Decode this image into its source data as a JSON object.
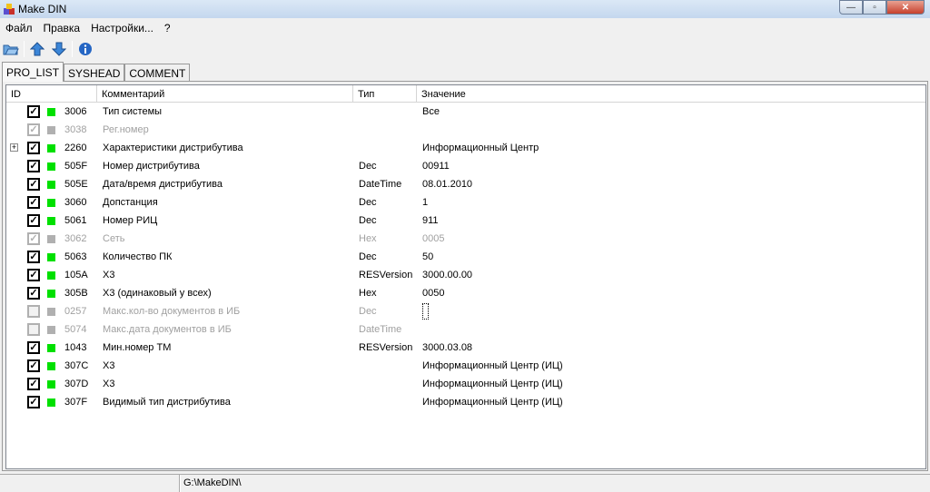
{
  "window": {
    "title": "Make DIN",
    "minimize": "—",
    "maximize": "▫",
    "close": "✕"
  },
  "menu": [
    "Файл",
    "Правка",
    "Настройки...",
    "?"
  ],
  "tabs": [
    "PRO_LIST",
    "SYSHEAD",
    "COMMENT"
  ],
  "columns": [
    "ID",
    "Комментарий",
    "Тип",
    "Значение"
  ],
  "rows": [
    {
      "id": "3006",
      "comment": "Тип системы",
      "type": "",
      "value": "Все",
      "checked": true,
      "enabled": true,
      "expand": false
    },
    {
      "id": "3038",
      "comment": "Рег.номер",
      "type": "",
      "value": "",
      "checked": true,
      "enabled": false,
      "expand": false
    },
    {
      "id": "2260",
      "comment": "Характеристики дистрибутива",
      "type": "",
      "value": "Информационный Центр",
      "checked": true,
      "enabled": true,
      "expand": true
    },
    {
      "id": "505F",
      "comment": "Номер дистрибутива",
      "type": "Dec",
      "value": "00911",
      "checked": true,
      "enabled": true,
      "expand": false
    },
    {
      "id": "505E",
      "comment": "Дата/время дистрибутива",
      "type": "DateTime",
      "value": "08.01.2010",
      "checked": true,
      "enabled": true,
      "expand": false
    },
    {
      "id": "3060",
      "comment": "Допстанция",
      "type": "Dec",
      "value": "1",
      "checked": true,
      "enabled": true,
      "expand": false
    },
    {
      "id": "5061",
      "comment": "Номер РИЦ",
      "type": "Dec",
      "value": "911",
      "checked": true,
      "enabled": true,
      "expand": false
    },
    {
      "id": "3062",
      "comment": "Сеть",
      "type": "Hex",
      "value": "0005",
      "checked": true,
      "enabled": false,
      "expand": false
    },
    {
      "id": "5063",
      "comment": "Количество ПК",
      "type": "Dec",
      "value": "50",
      "checked": true,
      "enabled": true,
      "expand": false
    },
    {
      "id": "105A",
      "comment": "Х3",
      "type": "RESVersion",
      "value": "3000.00.00",
      "checked": true,
      "enabled": true,
      "expand": false
    },
    {
      "id": "305B",
      "comment": "Х3 (одинаковый у всех)",
      "type": "Hex",
      "value": "0050",
      "checked": true,
      "enabled": true,
      "expand": false
    },
    {
      "id": "0257",
      "comment": "Макс.кол-во документов в ИБ",
      "type": "Dec",
      "value": "",
      "checked": false,
      "enabled": false,
      "expand": false,
      "focus": true
    },
    {
      "id": "5074",
      "comment": "Макс.дата документов в ИБ",
      "type": "DateTime",
      "value": "",
      "checked": false,
      "enabled": false,
      "expand": false
    },
    {
      "id": "1043",
      "comment": "Мин.номер ТМ",
      "type": "RESVersion",
      "value": "3000.03.08",
      "checked": true,
      "enabled": true,
      "expand": false
    },
    {
      "id": "307C",
      "comment": "Х3",
      "type": "",
      "value": "Информационный Центр (ИЦ)",
      "checked": true,
      "enabled": true,
      "expand": false
    },
    {
      "id": "307D",
      "comment": "Х3",
      "type": "",
      "value": "Информационный Центр (ИЦ)",
      "checked": true,
      "enabled": true,
      "expand": false
    },
    {
      "id": "307F",
      "comment": "Видимый тип дистрибутива",
      "type": "",
      "value": "Информационный Центр (ИЦ)",
      "checked": true,
      "enabled": true,
      "expand": false
    }
  ],
  "status": {
    "left": "",
    "path": "G:\\MakeDIN\\"
  },
  "colors": {
    "active": "#00e000",
    "disabled": "#b0b0b0"
  }
}
